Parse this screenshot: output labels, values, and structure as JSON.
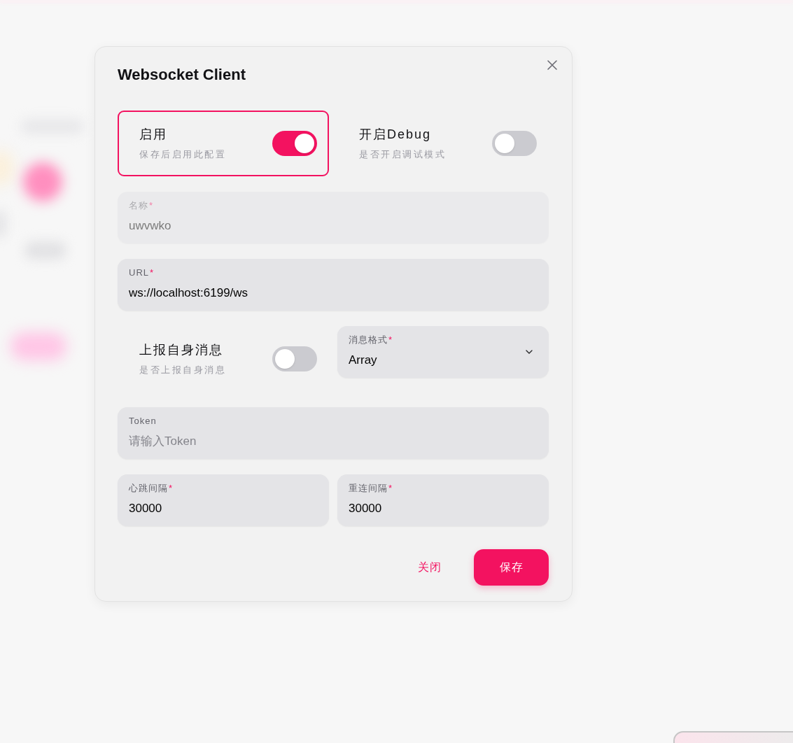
{
  "dialog": {
    "title": "Websocket Client"
  },
  "rows": [
    {
      "items": [
        {
          "kind": "switch",
          "label": "启用",
          "description": "保存后启用此配置",
          "on": true,
          "focused": true
        },
        {
          "kind": "switch",
          "label": "开启Debug",
          "description": "是否开启调试模式",
          "on": false,
          "focused": false
        }
      ]
    },
    {
      "items": [
        {
          "kind": "input",
          "label": "名称",
          "required_mark": "*",
          "value": "uwvwko",
          "disabled": true
        }
      ]
    },
    {
      "items": [
        {
          "kind": "input",
          "label": "URL",
          "required_mark": "*",
          "value": "ws://localhost:6199/ws",
          "disabled": false
        }
      ]
    },
    {
      "items": [
        {
          "kind": "switch",
          "label": "上报自身消息",
          "description": "是否上报自身消息",
          "on": false,
          "focused": false
        },
        {
          "kind": "select",
          "label": "消息格式",
          "required_mark": "*",
          "value": "Array"
        }
      ]
    },
    {
      "items": [
        {
          "kind": "input",
          "label": "Token",
          "placeholder": "请输入Token",
          "disabled": false
        }
      ]
    },
    {
      "items": [
        {
          "kind": "input",
          "label": "心跳间隔",
          "required_mark": "*",
          "value": "30000",
          "disabled": false
        },
        {
          "kind": "input",
          "label": "重连间隔",
          "required_mark": "*",
          "value": "30000",
          "disabled": false
        }
      ]
    }
  ],
  "footer": {
    "buttons": [
      {
        "kind": "text",
        "label": "关闭"
      },
      {
        "kind": "primary",
        "label": "保存"
      }
    ]
  }
}
